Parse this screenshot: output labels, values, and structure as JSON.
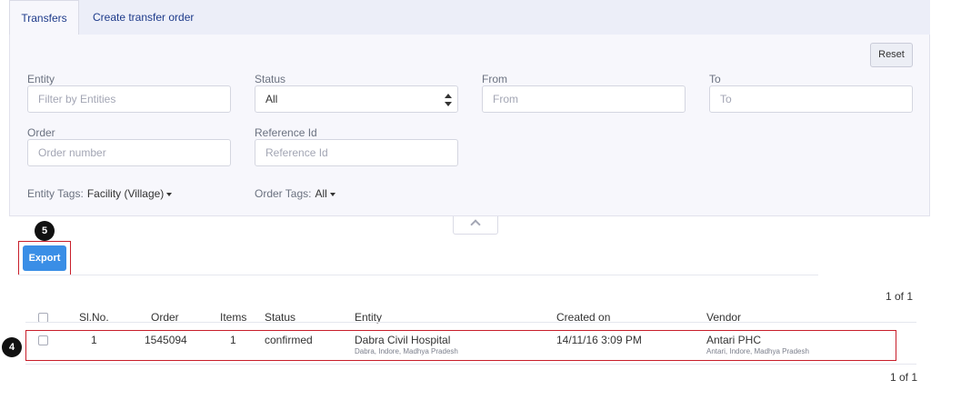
{
  "tabs": [
    {
      "label": "Transfers",
      "active": true
    },
    {
      "label": "Create transfer order",
      "active": false
    }
  ],
  "filters": {
    "reset_label": "Reset",
    "entity": {
      "label": "Entity",
      "placeholder": "Filter by Entities"
    },
    "status": {
      "label": "Status",
      "value": "All"
    },
    "from": {
      "label": "From",
      "placeholder": "From"
    },
    "to": {
      "label": "To",
      "placeholder": "To"
    },
    "order": {
      "label": "Order",
      "placeholder": "Order number"
    },
    "reference": {
      "label": "Reference Id",
      "placeholder": "Reference Id"
    },
    "entity_tags": {
      "label": "Entity Tags:",
      "value": "Facility (Village)"
    },
    "order_tags": {
      "label": "Order Tags:",
      "value": "All"
    }
  },
  "annotations": {
    "export_marker": "5",
    "row_marker": "4"
  },
  "export_label": "Export",
  "pagination": {
    "top": "1 of 1",
    "bottom": "1 of 1"
  },
  "table": {
    "headers": [
      "Sl.No.",
      "Order",
      "Items",
      "Status",
      "Entity",
      "Created on",
      "Vendor"
    ],
    "rows": [
      {
        "sl_no": "1",
        "order": "1545094",
        "items": "1",
        "status": "confirmed",
        "entity": "Dabra Civil Hospital",
        "entity_location": "Dabra, Indore, Madhya Pradesh",
        "created_on": "14/11/16 3:09 PM",
        "vendor": "Antari PHC",
        "vendor_location": "Antari, Indore, Madhya Pradesh"
      }
    ]
  },
  "colors": {
    "accent": "#3a8ee6",
    "highlight": "#c81e2a",
    "link": "#1d3a8a"
  }
}
